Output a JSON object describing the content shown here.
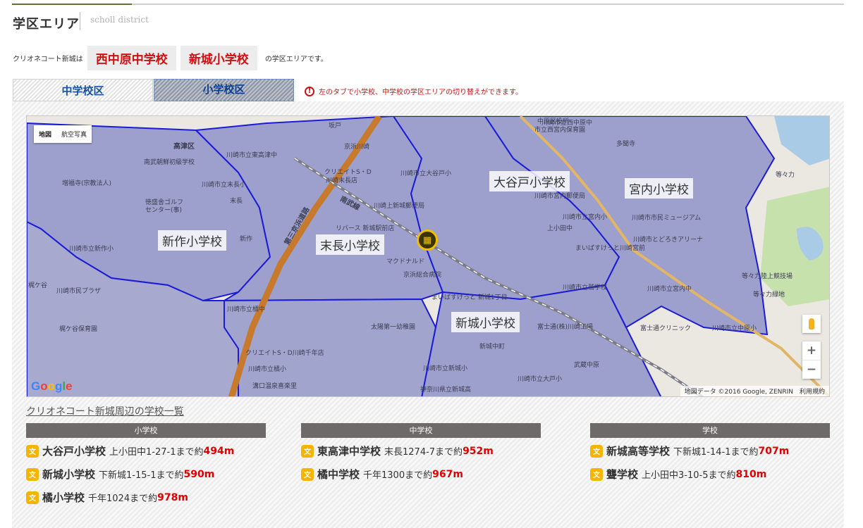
{
  "header": {
    "title": "学区エリア",
    "subtitle": "scholl district"
  },
  "intro": {
    "lead": "クリオネコート新城は",
    "schools": [
      "西中原中学校",
      "新城小学校"
    ],
    "tail": "の学区エリアです。"
  },
  "tabs": [
    {
      "label": "中学校区",
      "selected": false
    },
    {
      "label": "小学校区",
      "selected": true
    }
  ],
  "notice": {
    "icon": "exclamation-circle-icon",
    "text": "左のタブで小学校、中学校の学区エリアの切り替えができます。"
  },
  "map": {
    "type_buttons": [
      "地図",
      "航空写真"
    ],
    "zone_labels": [
      "大谷戸小学校",
      "宮内小学校",
      "新作小学校",
      "末長小学校",
      "新城小学校"
    ],
    "streets": [
      "高津区",
      "坂戸",
      "京浜川崎",
      "川崎市立東高津中",
      "南武朝鮮初級学校",
      "川崎市立末長小",
      "増福寺(宗教法人)",
      "徳盛舎ゴルフ",
      "センター(事)",
      "末長",
      "新作",
      "川崎市立新作小",
      "梶ケ谷",
      "川崎市民プラザ",
      "梶ケ谷保育園",
      "川崎市立橘中",
      "クリエイトS・D川崎千年店",
      "川崎市立橘小",
      "溝口温泉喜楽里",
      "クリエイトS・D",
      "川崎末長店",
      "川崎上新城郵便局",
      "リバース 新城駅前店",
      "マクドナルド",
      "京浜総合病院",
      "まいばすけっと 新城1丁目",
      "太陽第一幼稚園",
      "新城中町",
      "川崎市立新城小",
      "神奈川県立新城高",
      "川崎市立大戸小",
      "武蔵中原",
      "富士通(株)川崎工場",
      "川崎市立鷲学校",
      "川崎市宮内郵便局",
      "川崎市立宮内小",
      "上小田中",
      "まいばすけっと川崎宮前",
      "川崎市立西中原中",
      "川崎市とどろきアリーナ",
      "川崎市市民ミュージアム",
      "等々力陸上競技場",
      "等々力緑地",
      "川崎市立宮内中",
      "富士通クリニック",
      "川崎市立中原小",
      "多聞寺",
      "中原区役所",
      "市立西宮内保育園",
      "等々力",
      "南武線",
      "第三京浜道路",
      "川崎市立大谷戸小"
    ],
    "controls": {
      "zoom_in": "+",
      "zoom_out": "−"
    },
    "google": [
      "G",
      "o",
      "o",
      "g",
      "l",
      "e"
    ],
    "attribution": "地図データ ©2016 Google, ZENRIN　利用規約",
    "pin_icon": "building-icon"
  },
  "list": {
    "title": "クリオネコート新城周辺の学校一覧",
    "columns": [
      {
        "header": "小学校",
        "items": [
          {
            "name": "大谷戸小学校",
            "address": "上小田中1-27-1まで約",
            "distance": "494m"
          },
          {
            "name": "新城小学校",
            "address": "下新城1-15-1まで約",
            "distance": "590m"
          },
          {
            "name": "橘小学校",
            "address": "千年1024まで約",
            "distance": "978m"
          }
        ]
      },
      {
        "header": "中学校",
        "items": [
          {
            "name": "東高津中学校",
            "address": "末長1274-7まで約",
            "distance": "952m"
          },
          {
            "name": "橘中学校",
            "address": "千年1300まで約",
            "distance": "967m"
          }
        ]
      },
      {
        "header": "学校",
        "items": [
          {
            "name": "新城高等学校",
            "address": "下新城1-14-1まで約",
            "distance": "707m"
          },
          {
            "name": "聾学校",
            "address": "上小田中3-10-5まで約",
            "distance": "810m"
          }
        ]
      }
    ],
    "badge_icon": "school-icon",
    "badge_glyph": "文"
  },
  "colors": {
    "accent_red": "#e00000",
    "tab_blue": "#1652a8",
    "zone_fill": "#9da0cc",
    "zone_border": "#1b1bd8",
    "badge": "#f5b400"
  }
}
